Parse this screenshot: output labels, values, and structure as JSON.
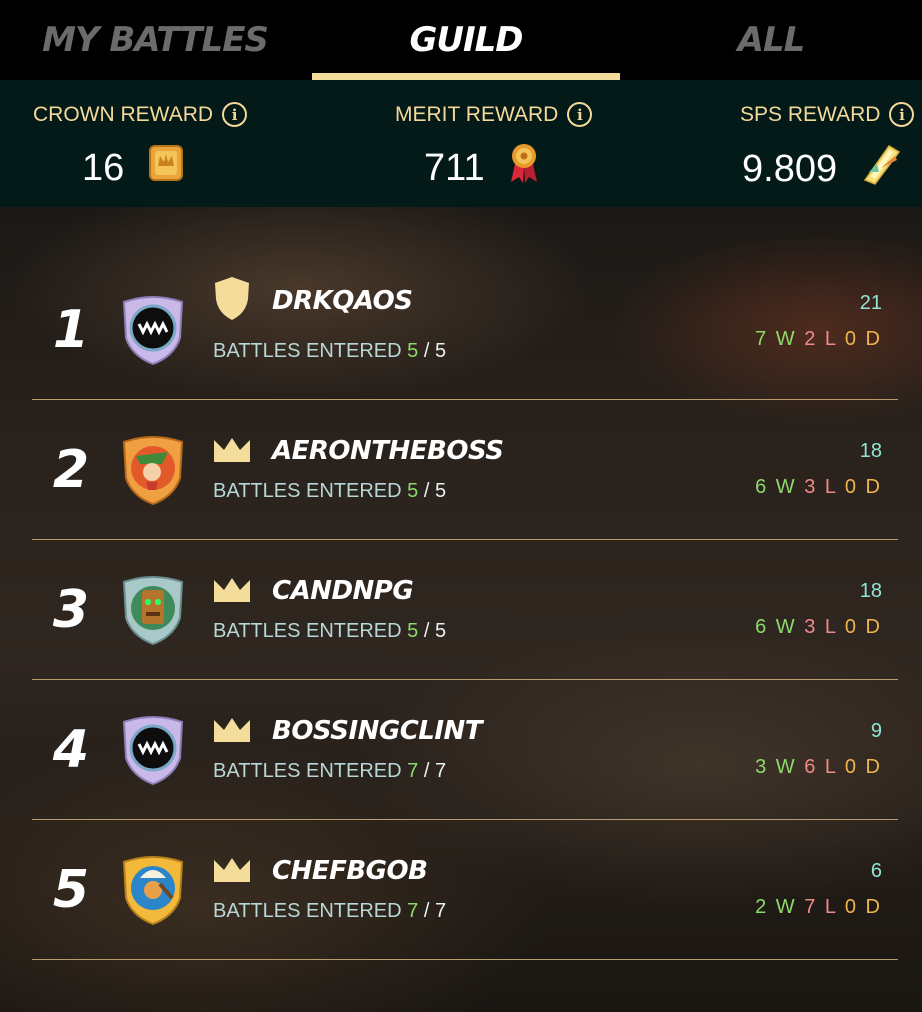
{
  "tabs": [
    {
      "label": "MY BATTLES",
      "active": false
    },
    {
      "label": "GUILD",
      "active": true
    },
    {
      "label": "ALL",
      "active": false
    }
  ],
  "rewards": {
    "crown": {
      "label": "CROWN REWARD",
      "value": "16",
      "icon": "crown-token-icon"
    },
    "merit": {
      "label": "MERIT REWARD",
      "value": "711",
      "icon": "merit-medal-icon"
    },
    "sps": {
      "label": "SPS REWARD",
      "value": "9.809",
      "icon": "sps-crystal-icon"
    },
    "info_glyph": "i"
  },
  "colors": {
    "accent_gold": "#f4dc9a",
    "win": "#8ed96b",
    "loss": "#f08a8a",
    "draw": "#f0b44a",
    "score": "#8fe4d4"
  },
  "battles_label": "BATTLES ENTERED",
  "players": [
    {
      "rank": "1",
      "name": "DRKQAOS",
      "badge": "shield-icon",
      "avatar": "fanged-mouth-avatar",
      "battles_done": "5",
      "battles_total": "5",
      "score": "21",
      "wins": "7",
      "losses": "2",
      "draws": "0"
    },
    {
      "rank": "2",
      "name": "AERONTHEBOSS",
      "badge": "crown-icon",
      "avatar": "elf-archer-avatar",
      "battles_done": "5",
      "battles_total": "5",
      "score": "18",
      "wins": "6",
      "losses": "3",
      "draws": "0"
    },
    {
      "rank": "3",
      "name": "CANDNPG",
      "badge": "crown-icon",
      "avatar": "tiki-totem-avatar",
      "battles_done": "5",
      "battles_total": "5",
      "score": "18",
      "wins": "6",
      "losses": "3",
      "draws": "0"
    },
    {
      "rank": "4",
      "name": "BOSSINGCLINT",
      "badge": "crown-icon",
      "avatar": "fanged-mouth-avatar",
      "battles_done": "7",
      "battles_total": "7",
      "score": "9",
      "wins": "3",
      "losses": "6",
      "draws": "0"
    },
    {
      "rank": "5",
      "name": "CHEFBGOB",
      "badge": "crown-icon",
      "avatar": "goblin-chef-avatar",
      "battles_done": "7",
      "battles_total": "7",
      "score": "6",
      "wins": "2",
      "losses": "7",
      "draws": "0"
    }
  ],
  "record_letters": {
    "win": "W",
    "loss": "L",
    "draw": "D"
  }
}
